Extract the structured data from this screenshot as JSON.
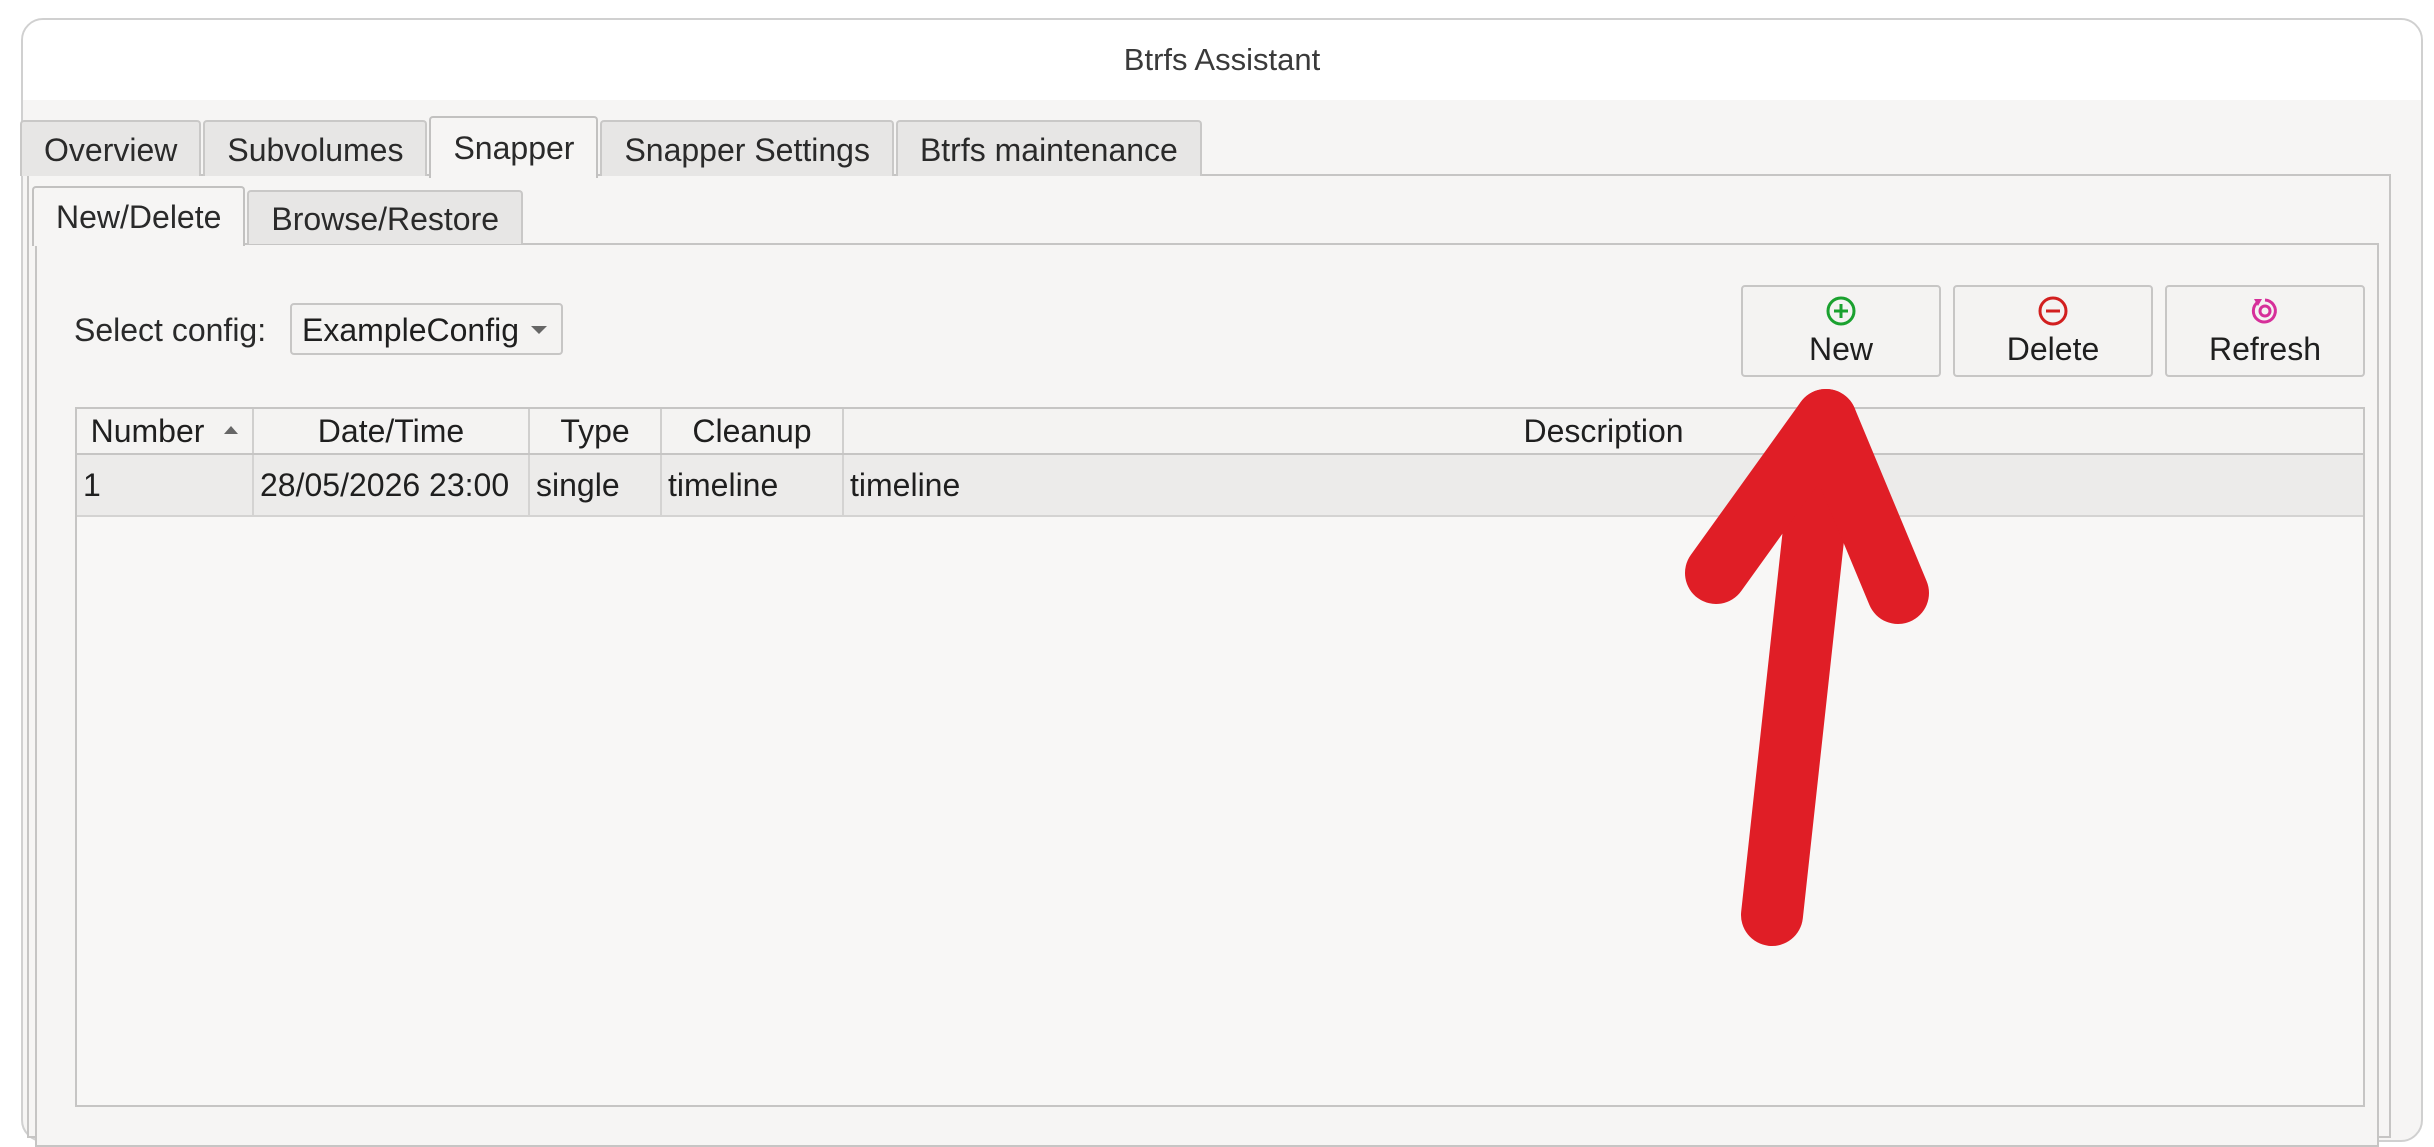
{
  "window": {
    "title": "Btrfs Assistant"
  },
  "tabs": [
    {
      "label": "Overview",
      "active": false
    },
    {
      "label": "Subvolumes",
      "active": false
    },
    {
      "label": "Snapper",
      "active": true
    },
    {
      "label": "Snapper Settings",
      "active": false
    },
    {
      "label": "Btrfs maintenance",
      "active": false
    }
  ],
  "subtabs": [
    {
      "label": "New/Delete",
      "active": true
    },
    {
      "label": "Browse/Restore",
      "active": false
    }
  ],
  "config": {
    "label": "Select config:",
    "value": "ExampleConfig"
  },
  "toolbar": {
    "new_label": "New",
    "new_icon": "plus-circle-icon",
    "new_color": "#1aa12f",
    "delete_label": "Delete",
    "delete_icon": "minus-circle-icon",
    "delete_color": "#d21f1f",
    "refresh_label": "Refresh",
    "refresh_icon": "refresh-icon",
    "refresh_color": "#d62f9a"
  },
  "table": {
    "columns": [
      "Number",
      "Date/Time",
      "Type",
      "Cleanup",
      "Description"
    ],
    "sorted_column": "Number",
    "rows": [
      {
        "number": "1",
        "datetime": "28/05/2026 23:00",
        "type": "single",
        "cleanup": "timeline",
        "description": "timeline"
      }
    ]
  },
  "annotation": {
    "kind": "arrow",
    "points_to": "new-button",
    "color": "#e01e26"
  }
}
